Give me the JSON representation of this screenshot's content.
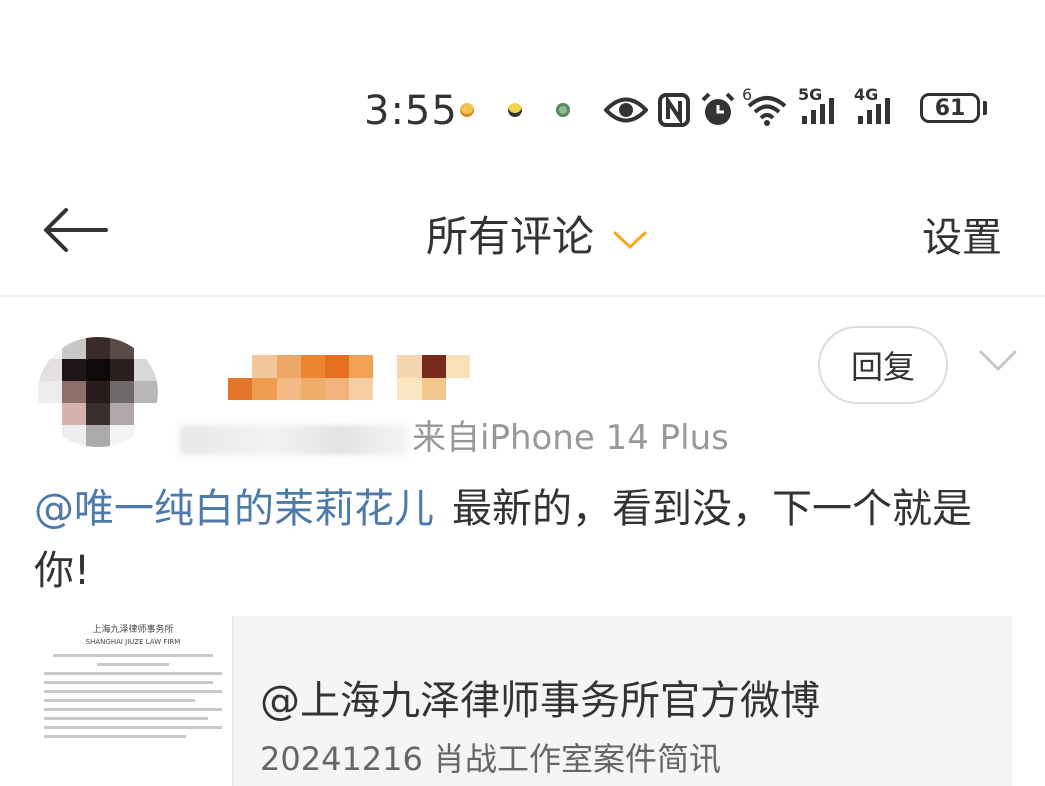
{
  "status_bar": {
    "time": "3:55",
    "icons": [
      "emoji-icon",
      "emoji-icon",
      "emoji-icon",
      "eye-icon",
      "nfc-icon",
      "alarm-icon",
      "wifi-icon",
      "signal-5g-icon",
      "signal-4g-icon"
    ],
    "wifi_label": "6",
    "net1_label": "5G",
    "net2_label": "4G",
    "battery": "61"
  },
  "nav": {
    "title": "所有评论",
    "settings_label": "设置",
    "accent": "#f5a623"
  },
  "comment": {
    "source": "来自iPhone 14 Plus",
    "reply_label": "回复",
    "mention": "@唯一纯白的茉莉花儿",
    "text": "最新的，看到没，下一个就是你!",
    "mention_color": "#4d7aa8"
  },
  "card": {
    "doc_header_line1": "上海九泽律师事务所",
    "doc_header_line2": "SHANGHAI JIUZE LAW FIRM",
    "title": "@上海九泽律师事务所官方微博",
    "subtitle": "20241216 肖战工作室案件简讯"
  }
}
